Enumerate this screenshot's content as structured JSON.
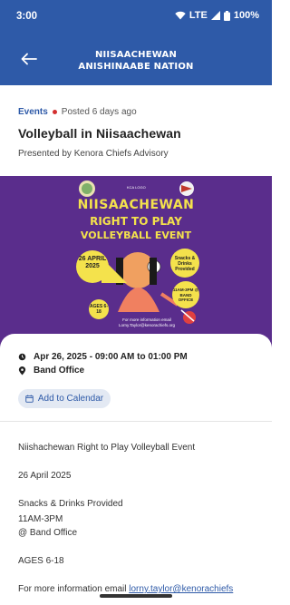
{
  "status_bar": {
    "time": "3:00",
    "network": "LTE",
    "battery": "100%"
  },
  "header": {
    "title_line1": "NIISAACHEWAN",
    "title_line2": "ANISHINAABE NATION",
    "back_icon": "arrow-left-icon",
    "color": "#2e5aa8"
  },
  "event": {
    "category": "Events",
    "posted": "Posted 6 days ago",
    "title": "Volleyball in Niisaachewan",
    "presented_by": "Presented by Kenora Chiefs Advisory",
    "tag_color": "#d32f2f"
  },
  "poster": {
    "top_label": "KCA LOGO",
    "title_line1": "NIISAACHEWAN",
    "title_line2": "RIGHT TO PLAY",
    "title_line3": "VOLLEYBALL EVENT",
    "date": "26 APRIL 2025",
    "snacks": "Snacks & Drinks Provided",
    "time": "11AM-3PM @ BAND OFFICE",
    "ages": "AGES 6-18",
    "info": "For more information email Lorny.Taylor@kenorachiefs.org",
    "background": "#5a2d8c",
    "accent": "#f4e24c"
  },
  "details": {
    "datetime": "Apr 26, 2025 - 09:00 AM to 01:00 PM",
    "location": "Band Office",
    "add_to_calendar": "Add to Calendar",
    "clock_icon": "clock-icon",
    "pin_icon": "map-pin-icon",
    "calendar_icon": "calendar-icon"
  },
  "description": {
    "line1": "Niishachewan Right to Play Volleyball Event",
    "line2": "26 April 2025",
    "line3": "Snacks & Drinks Provided",
    "line4": "11AM-3PM",
    "line5": "@ Band Office",
    "line6": "AGES 6-18",
    "line7_prefix": "For more information email ",
    "line7_email": "lorny.taylor@kenorachiefs"
  }
}
